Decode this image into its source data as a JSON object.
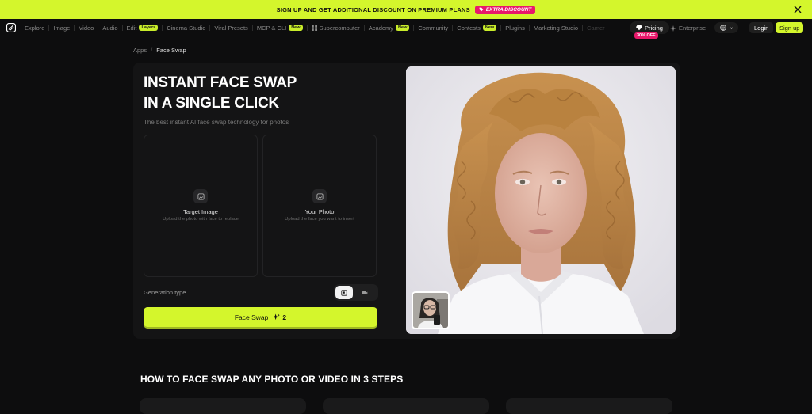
{
  "promo": {
    "text": "SIGN UP AND GET ADDITIONAL DISCOUNT ON PREMIUM PLANS",
    "badge": "EXTRA DISCOUNT",
    "close_icon": "close-icon"
  },
  "nav": {
    "items": [
      {
        "label": "Explore"
      },
      {
        "label": "Image"
      },
      {
        "label": "Video"
      },
      {
        "label": "Audio"
      },
      {
        "label": "Edit",
        "badge": "Layers"
      },
      {
        "label": "Cinema Studio"
      },
      {
        "label": "Viral Presets"
      },
      {
        "label": "MCP & CLI",
        "badge": "New"
      },
      {
        "label": "Supercomputer"
      },
      {
        "label": "Academy",
        "badge": "New"
      },
      {
        "label": "Community"
      },
      {
        "label": "Contests",
        "badge": "New"
      },
      {
        "label": "Plugins"
      },
      {
        "label": "Marketing Studio"
      },
      {
        "label": "Camer"
      }
    ],
    "pricing": "Pricing",
    "pricing_badge": "30% OFF",
    "enterprise": "Enterprise",
    "login": "Login",
    "signup": "Sign up"
  },
  "breadcrumb": {
    "parent": "Apps",
    "separator": "/",
    "current": "Face Swap"
  },
  "hero": {
    "title_line1": "INSTANT FACE SWAP",
    "title_line2": "IN A SINGLE CLICK",
    "subtitle": "The best instant AI face swap technology for photos"
  },
  "uploads": {
    "target": {
      "label": "Target Image",
      "hint": "Upload the photo with face to replace"
    },
    "yours": {
      "label": "Your Photo",
      "hint": "Upload the face you want to insert"
    }
  },
  "generation": {
    "label": "Generation type",
    "selected": "image"
  },
  "action": {
    "label": "Face Swap",
    "cost": "2"
  },
  "steps": {
    "heading": "HOW TO FACE SWAP ANY PHOTO OR VIDEO IN 3 STEPS"
  },
  "colors": {
    "accent": "#d4f62c",
    "background": "#0d0d0e",
    "card": "#141415",
    "pink": "#e8186b"
  }
}
